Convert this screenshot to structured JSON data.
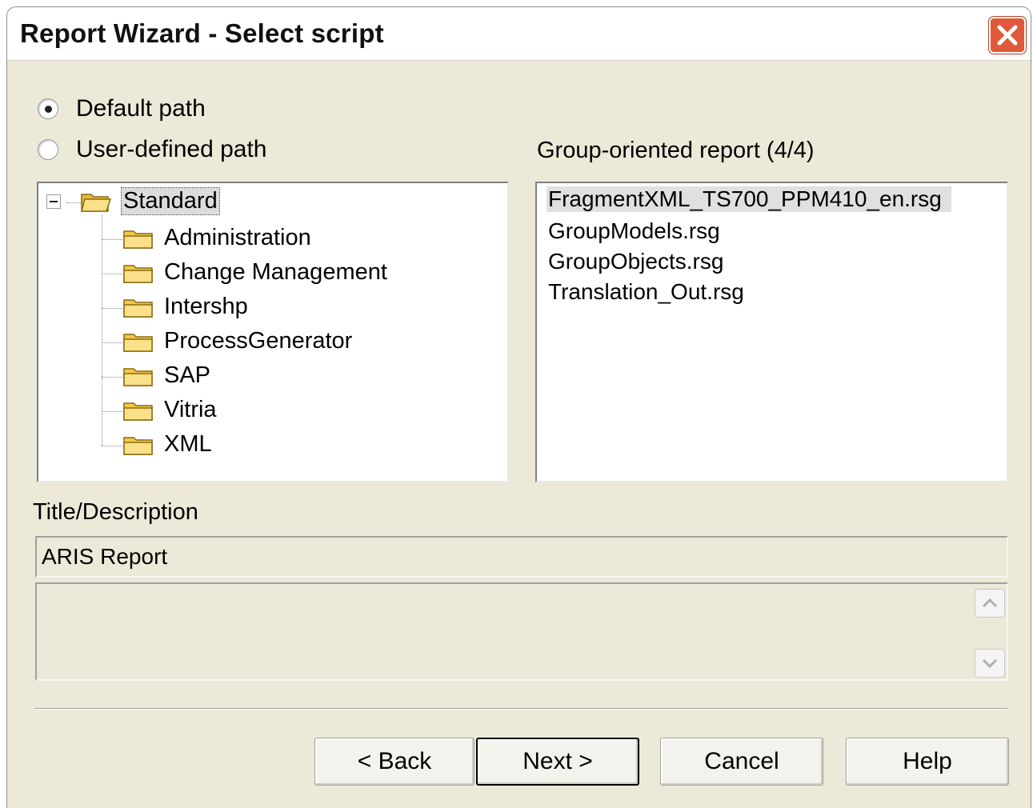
{
  "window": {
    "title": "Report Wizard - Select script"
  },
  "path_options": [
    {
      "label": "Default path",
      "selected": true
    },
    {
      "label": "User-defined path",
      "selected": false
    }
  ],
  "tree": {
    "root": "Standard",
    "children": [
      "Administration",
      "Change Management",
      "Intershp",
      "ProcessGenerator",
      "SAP",
      "Vitria",
      "XML"
    ]
  },
  "scripts": {
    "header": "Group-oriented report (4/4)",
    "items": [
      "FragmentXML_TS700_PPM410_en.rsg",
      "GroupModels.rsg",
      "GroupObjects.rsg",
      "Translation_Out.rsg"
    ],
    "selected_index": 0
  },
  "description": {
    "label": "Title/Description",
    "title_value": "ARIS Report",
    "body_value": ""
  },
  "buttons": {
    "back": "< Back",
    "next": "Next >",
    "cancel": "Cancel",
    "help": "Help"
  }
}
